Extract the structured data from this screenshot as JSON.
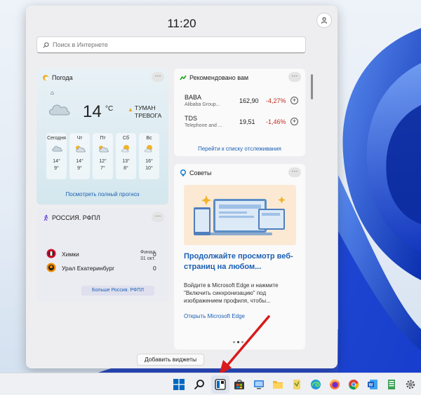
{
  "panel": {
    "time": "11:20",
    "search_placeholder": "Поиск в Интернете",
    "add_widgets_label": "Добавить виджеты"
  },
  "weather": {
    "title": "Погода",
    "temperature": "14",
    "unit": "°C",
    "alert": "ТУМАН ТРЕВОГА",
    "forecast": [
      {
        "day": "Сегодня",
        "high": "14°",
        "low": "9°",
        "icon": "cloud-icon"
      },
      {
        "day": "Чт",
        "high": "14°",
        "low": "9°",
        "icon": "partly-cloudy-icon"
      },
      {
        "day": "Пт",
        "high": "12°",
        "low": "7°",
        "icon": "partly-cloudy-icon"
      },
      {
        "day": "Сб",
        "high": "13°",
        "low": "8°",
        "icon": "sun-cloud-icon"
      },
      {
        "day": "Вс",
        "high": "16°",
        "low": "10°",
        "icon": "sun-cloud-icon"
      }
    ],
    "link": "Посмотреть полный прогноз"
  },
  "stocks": {
    "title": "Рекомендовано вам",
    "items": [
      {
        "symbol": "BABA",
        "company": "Alibaba Group...",
        "price": "162,90",
        "change": "-4,27%"
      },
      {
        "symbol": "TDS",
        "company": "Telephone and ...",
        "price": "19,51",
        "change": "-1,46%"
      }
    ],
    "link": "Перейти к списку отслеживания"
  },
  "sports": {
    "title": "РОССИЯ. РФПЛ",
    "teams": [
      {
        "name": "Химки",
        "score": "0"
      },
      {
        "name": "Урал Екатеринбург",
        "score": "0"
      }
    ],
    "final_label": "Финал",
    "final_date": "31 окт.",
    "link": "Больше Россия. РФПЛ"
  },
  "tips": {
    "title": "Советы",
    "headline": "Продолжайте просмотр веб-страниц на любом...",
    "body": "Войдите в Microsoft Edge и нажмите \"Включить синхронизацию\" под изображением профиля, чтобы...",
    "link": "Открыть Microsoft Edge"
  },
  "more_label": "···",
  "colors": {
    "accent": "#1a5fb4",
    "negative": "#c42b1c",
    "alert": "#e3a51b",
    "wallpaper_blue": "#1f52d6"
  }
}
